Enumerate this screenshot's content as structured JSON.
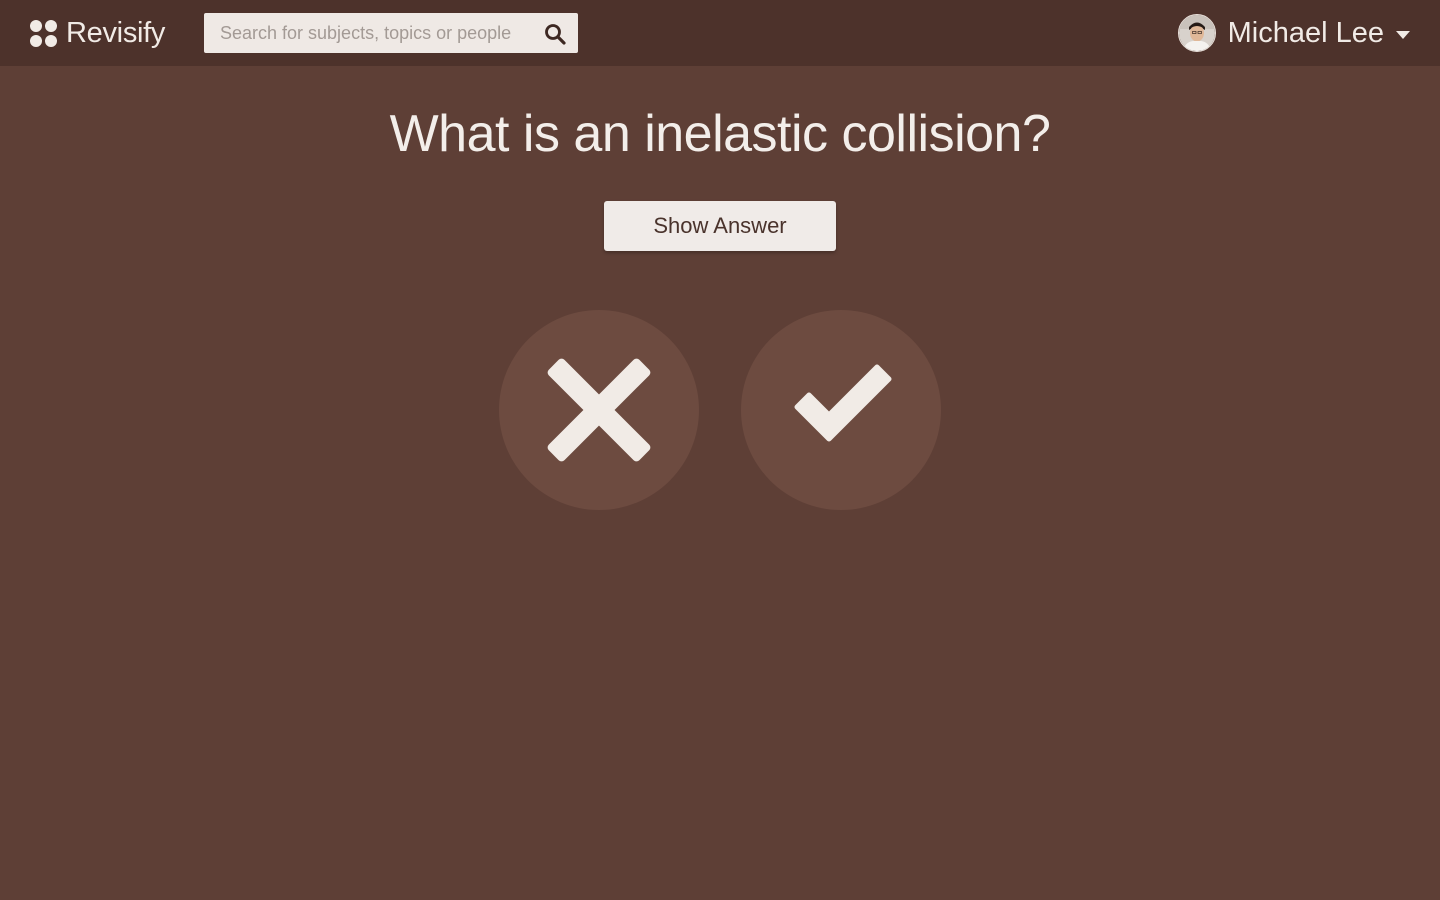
{
  "header": {
    "brand": "Revisify",
    "search": {
      "placeholder": "Search for subjects, topics or people",
      "value": ""
    },
    "user": {
      "name": "Michael Lee"
    }
  },
  "card": {
    "question": "What is an inelastic collision?",
    "show_answer_label": "Show Answer"
  },
  "icons": {
    "logo": "four-dots-logo-icon",
    "search": "magnifier-icon",
    "dropdown": "caret-down-icon",
    "wrong": "cross-icon",
    "right": "check-icon"
  },
  "colors": {
    "background": "#5e3f36",
    "topbar": "#4d322b",
    "circle": "#6d4b40",
    "foreground": "#f1ebe6"
  }
}
